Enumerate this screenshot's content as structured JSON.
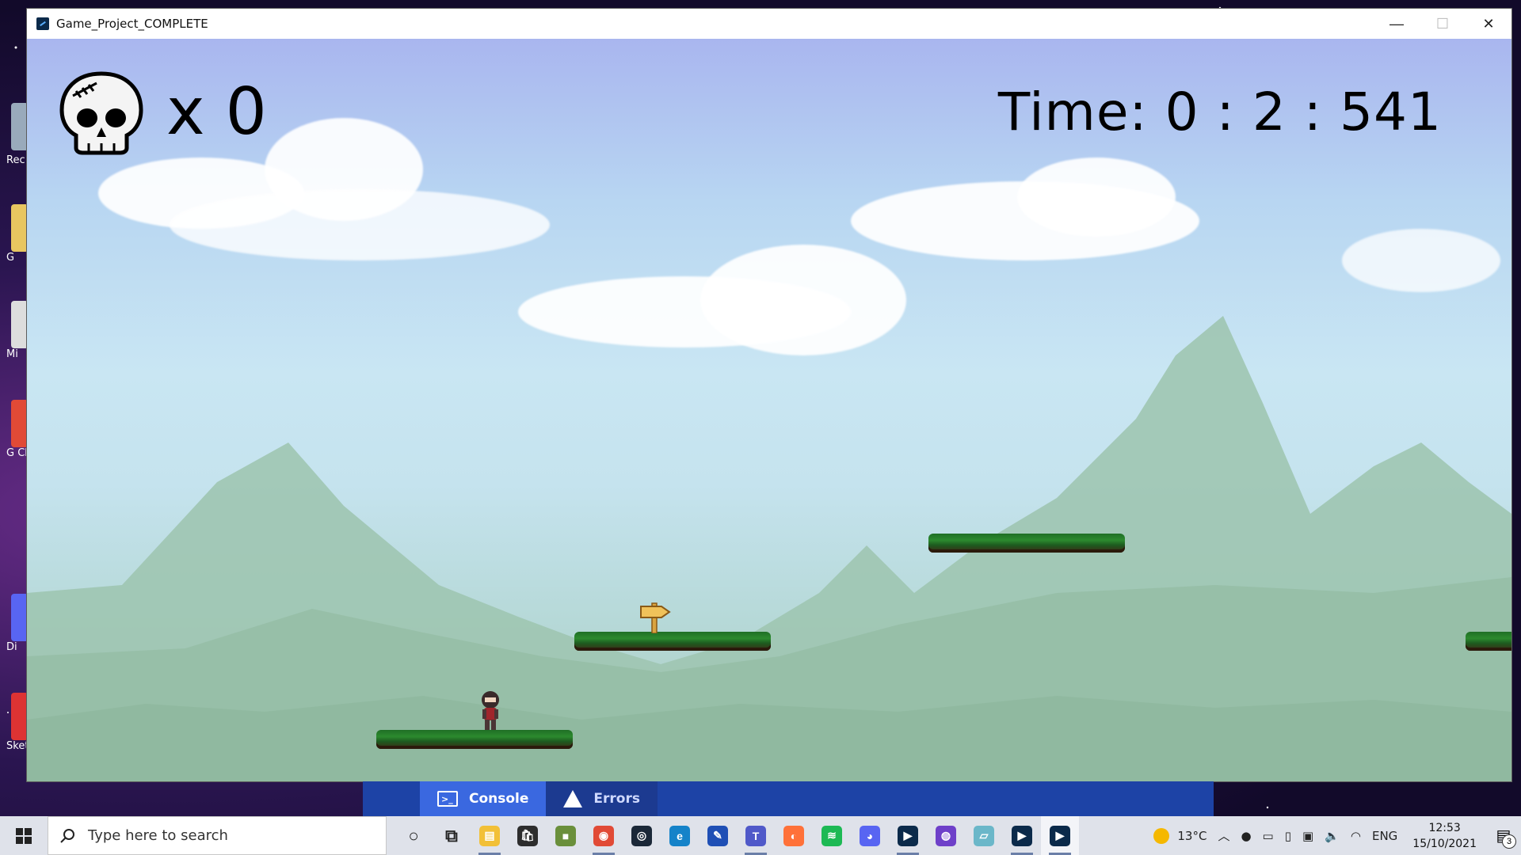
{
  "window": {
    "title": "Game_Project_COMPLETE",
    "controls": {
      "minimize": "—",
      "maximize": "☐",
      "close": "✕"
    }
  },
  "game": {
    "death_count": "x 0",
    "time_display": "Time: 0 : 2 : 541"
  },
  "desktop": {
    "icon_labels": [
      "Rec",
      "G",
      "Mi",
      "G Ch",
      "Di",
      "Sket"
    ]
  },
  "console_panel": {
    "tabs": [
      {
        "label": "Console",
        "icon": "console-icon",
        "active": true
      },
      {
        "label": "Errors",
        "icon": "warning-icon",
        "active": false
      }
    ]
  },
  "taskbar": {
    "search_placeholder": "Type here to search",
    "apps": [
      {
        "name": "cortana-icon",
        "glyph": "○",
        "color": "#222222",
        "running": false
      },
      {
        "name": "task-view-icon",
        "glyph": "⧉",
        "color": "#222222",
        "running": false
      },
      {
        "name": "file-explorer-icon",
        "glyph": "▤",
        "color": "#f2c037",
        "running": true
      },
      {
        "name": "store-icon",
        "glyph": "🛍",
        "color": "#2d2d2d",
        "running": false
      },
      {
        "name": "minecraft-icon",
        "glyph": "■",
        "color": "#6a8f3b",
        "running": false
      },
      {
        "name": "chrome-icon",
        "glyph": "◉",
        "color": "#e14a36",
        "running": true
      },
      {
        "name": "steam-icon",
        "glyph": "◎",
        "color": "#1b2838",
        "running": false
      },
      {
        "name": "edge-icon",
        "glyph": "e",
        "color": "#1583c9",
        "running": false
      },
      {
        "name": "whiteboard-icon",
        "glyph": "✎",
        "color": "#1f4fb5",
        "running": false
      },
      {
        "name": "teams-icon",
        "glyph": "T",
        "color": "#5059c9",
        "running": true
      },
      {
        "name": "firefox-icon",
        "glyph": "◐",
        "color": "#ff7139",
        "running": false
      },
      {
        "name": "spotify-icon",
        "glyph": "≋",
        "color": "#1db954",
        "running": false
      },
      {
        "name": "discord-icon",
        "glyph": "◕",
        "color": "#5865f2",
        "running": false
      },
      {
        "name": "processing-icon",
        "glyph": "▶",
        "color": "#0b2a4a",
        "running": true
      },
      {
        "name": "github-icon",
        "glyph": "◍",
        "color": "#6e40c9",
        "running": false
      },
      {
        "name": "notes-icon",
        "glyph": "▱",
        "color": "#6bb7c9",
        "running": false
      },
      {
        "name": "processing-icon-2",
        "glyph": "▶",
        "color": "#0b2a4a",
        "running": true
      },
      {
        "name": "processing-icon-3",
        "glyph": "▶",
        "color": "#0b2a4a",
        "running": true,
        "active": true
      }
    ],
    "tray": {
      "weather": "13°C",
      "language": "ENG",
      "time": "12:53",
      "date": "15/10/2021",
      "notification_count": "3"
    }
  }
}
